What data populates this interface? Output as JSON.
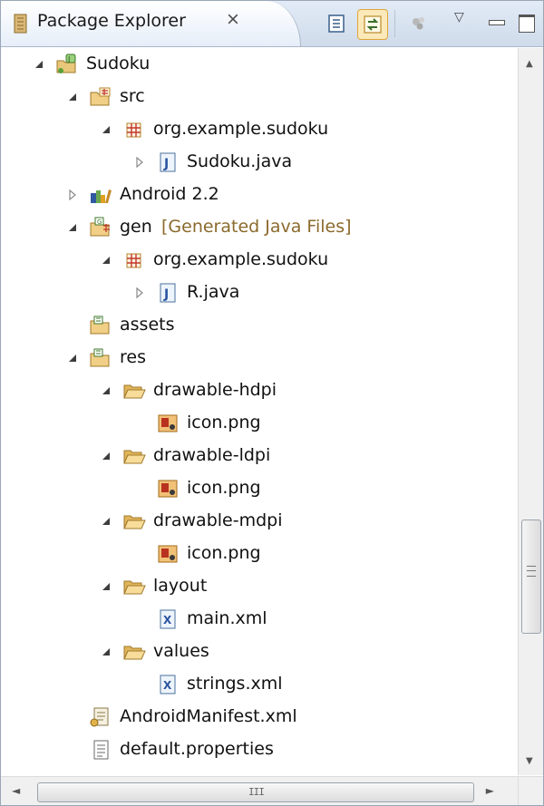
{
  "view": {
    "title": "Package Explorer",
    "close_symbol": "⨯",
    "toolbar": {
      "collapse_all": "collapse-all-icon",
      "link_with_editor": "link-with-editor-icon",
      "focus": "focus-icon",
      "view_menu": "view-menu-icon",
      "minimize": "minimize-icon",
      "maximize": "maximize-icon"
    }
  },
  "tree": [
    {
      "label": "Sudoku",
      "decoration": "",
      "expanded": true,
      "icon": "android-project-icon"
    },
    {
      "label": "src",
      "decoration": "",
      "expanded": true,
      "icon": "source-folder-icon"
    },
    {
      "label": "org.example.sudoku",
      "decoration": "",
      "expanded": true,
      "icon": "package-icon"
    },
    {
      "label": "Sudoku.java",
      "decoration": "",
      "expanded": false,
      "icon": "java-file-icon"
    },
    {
      "label": "Android 2.2",
      "decoration": "",
      "expanded": false,
      "icon": "library-icon"
    },
    {
      "label": "gen",
      "decoration": "[Generated Java Files]",
      "expanded": true,
      "icon": "generated-folder-icon"
    },
    {
      "label": "org.example.sudoku",
      "decoration": "",
      "expanded": true,
      "icon": "package-icon"
    },
    {
      "label": "R.java",
      "decoration": "",
      "expanded": false,
      "icon": "java-file-icon"
    },
    {
      "label": "assets",
      "decoration": "",
      "expanded": null,
      "icon": "folder-icon"
    },
    {
      "label": "res",
      "decoration": "",
      "expanded": true,
      "icon": "folder-icon"
    },
    {
      "label": "drawable-hdpi",
      "decoration": "",
      "expanded": true,
      "icon": "open-folder-icon"
    },
    {
      "label": "icon.png",
      "decoration": "",
      "expanded": null,
      "icon": "image-file-icon"
    },
    {
      "label": "drawable-ldpi",
      "decoration": "",
      "expanded": true,
      "icon": "open-folder-icon"
    },
    {
      "label": "icon.png",
      "decoration": "",
      "expanded": null,
      "icon": "image-file-icon"
    },
    {
      "label": "drawable-mdpi",
      "decoration": "",
      "expanded": true,
      "icon": "open-folder-icon"
    },
    {
      "label": "icon.png",
      "decoration": "",
      "expanded": null,
      "icon": "image-file-icon"
    },
    {
      "label": "layout",
      "decoration": "",
      "expanded": true,
      "icon": "open-folder-icon"
    },
    {
      "label": "main.xml",
      "decoration": "",
      "expanded": null,
      "icon": "xml-file-icon"
    },
    {
      "label": "values",
      "decoration": "",
      "expanded": true,
      "icon": "open-folder-icon"
    },
    {
      "label": "strings.xml",
      "decoration": "",
      "expanded": null,
      "icon": "xml-file-icon"
    },
    {
      "label": "AndroidManifest.xml",
      "decoration": "",
      "expanded": null,
      "icon": "manifest-file-icon"
    },
    {
      "label": "default.properties",
      "decoration": "",
      "expanded": null,
      "icon": "properties-file-icon"
    }
  ],
  "scrollbar": {
    "vertical_grip": "≡",
    "horizontal_grip": "III"
  },
  "colors": {
    "header_bg": "#dbe5f2",
    "decoration_text": "#8b6a2c",
    "link_button_bg": "#fbe9b9"
  }
}
